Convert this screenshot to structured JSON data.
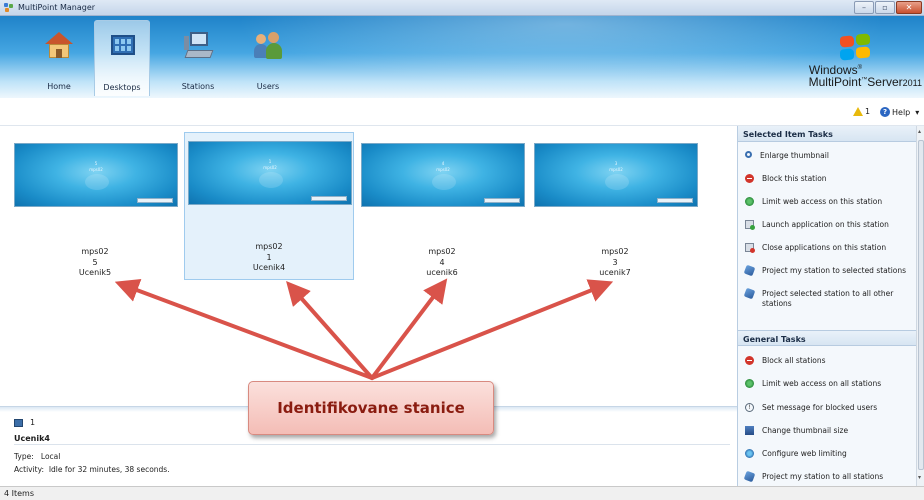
{
  "window": {
    "title": "MultiPoint Manager",
    "buttons": {
      "minimize": "–",
      "maximize": "▫",
      "close": "✕"
    }
  },
  "ribbon": {
    "tabs": [
      {
        "label": "Home",
        "icon": "house-icon"
      },
      {
        "label": "Desktops",
        "icon": "desktops-icon",
        "selected": true
      },
      {
        "label": "Stations",
        "icon": "stations-icon"
      },
      {
        "label": "Users",
        "icon": "users-icon"
      }
    ],
    "brand_line1": "Windows",
    "brand_line1_mark": "®",
    "brand_line2_a": "MultiPoint",
    "brand_line2_mark": "™",
    "brand_line2_b": "Server",
    "brand_line2_year": "2011"
  },
  "header": {
    "warning_count": "1",
    "help_label": "Help",
    "help_glyph": "?",
    "help_caret": "▾"
  },
  "desktops": [
    {
      "thumb_number": "5",
      "thumb_host": "mps02",
      "host": "mps02",
      "number": "5",
      "user": "Ucenik5"
    },
    {
      "thumb_number": "1",
      "thumb_host": "mps02",
      "host": "mps02",
      "number": "1",
      "user": "Ucenik4",
      "selected": true
    },
    {
      "thumb_number": "4",
      "thumb_host": "mps02",
      "host": "mps02",
      "number": "4",
      "user": "ucenik6"
    },
    {
      "thumb_number": "3",
      "thumb_host": "mps02",
      "host": "mps02",
      "number": "3",
      "user": "ucenik7"
    }
  ],
  "callout": {
    "text": "Identifikovane stanice"
  },
  "details": {
    "station_number": "1",
    "user_name": "Ucenik4",
    "type_label": "Type:",
    "type_value": "Local",
    "activity_label": "Activity:",
    "activity_value": "Idle for 32 minutes, 38 seconds."
  },
  "status_bar": {
    "text": "4 Items"
  },
  "task_pane": {
    "selected_heading": "Selected Item Tasks",
    "selected_tasks": [
      {
        "label": "Enlarge thumbnail",
        "icon": "magnifier-icon"
      },
      {
        "label": "Block this station",
        "icon": "block-icon"
      },
      {
        "label": "Limit web access on this station",
        "icon": "web-icon"
      },
      {
        "label": "Launch application on this station",
        "icon": "launch-app-icon"
      },
      {
        "label": "Close applications on this station",
        "icon": "close-app-icon"
      },
      {
        "label": "Project my station to selected stations",
        "icon": "project-icon"
      },
      {
        "label": "Project selected station to all other stations",
        "icon": "project-icon"
      }
    ],
    "general_heading": "General Tasks",
    "general_tasks": [
      {
        "label": "Block all stations",
        "icon": "block-icon"
      },
      {
        "label": "Limit web access on all stations",
        "icon": "web-icon"
      },
      {
        "label": "Set message for blocked users",
        "icon": "info-icon"
      },
      {
        "label": "Change thumbnail size",
        "icon": "thumbnail-size-icon"
      },
      {
        "label": "Configure web limiting",
        "icon": "web-config-icon"
      },
      {
        "label": "Project my station to all stations",
        "icon": "project-icon"
      }
    ]
  },
  "colors": {
    "ribbon_top": "#1f83c9",
    "callout_text": "#8a1c10",
    "arrow": "#d9534a"
  }
}
